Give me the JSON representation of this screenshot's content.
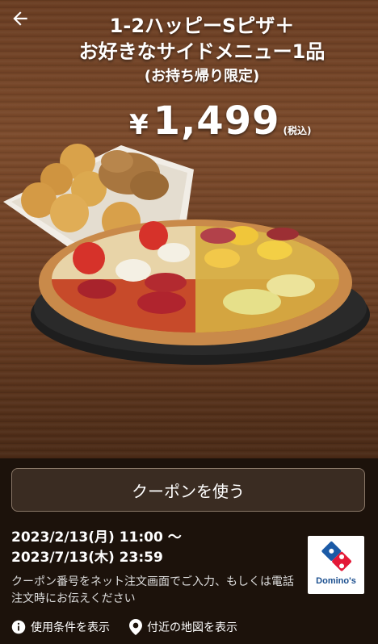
{
  "header": {
    "back_icon": "back-arrow-icon",
    "title_line1": "1-2ハッピーSピザ＋",
    "title_line2": "お好きなサイドメニュー1品",
    "title_line3": "(お持ち帰り限定)",
    "price_symbol": "¥",
    "price_value": "1,499",
    "price_tax_note": "(税込)"
  },
  "coupon_button": {
    "label": "クーポンを使う"
  },
  "validity": {
    "start": "2023/2/13(月) 11:00 ～",
    "end": "2023/7/13(木) 23:59"
  },
  "brand": {
    "logo_text": "Domino's",
    "colors": {
      "blue": "#1b5aa6",
      "red": "#e31837"
    }
  },
  "note": "クーポン番号をネット注文画面でご入力、もしくは電話注文時にお伝えください",
  "links": [
    {
      "icon": "info-icon",
      "label": "使用条件を表示"
    },
    {
      "icon": "location-pin-icon",
      "label": "付近の地図を表示"
    }
  ]
}
